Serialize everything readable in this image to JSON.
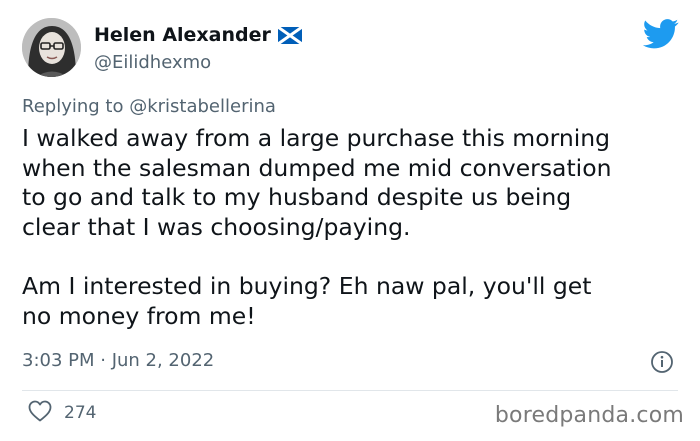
{
  "author": {
    "display_name": "Helen Alexander",
    "handle": "@Eilidhexmo",
    "flag_icon": "scotland-flag-icon",
    "avatar_icon": "profile-photo"
  },
  "brand": {
    "icon": "twitter-bird-icon",
    "color": "#1d9bf0"
  },
  "reply": {
    "prefix": "Replying to",
    "mention": "@kristabellerina"
  },
  "tweet": {
    "lines_paragraph_1": [
      "I walked away from a large purchase this morning",
      "when the salesman dumped me mid conversation",
      "to go and talk to my husband despite us being",
      "clear that I was choosing/paying."
    ],
    "lines_paragraph_2": [
      "Am I interested in buying?  Eh naw pal, you'll get",
      "no money from me!"
    ]
  },
  "meta": {
    "timestamp": "3:03 PM · Jun 2, 2022",
    "info_icon": "info-icon"
  },
  "engagement": {
    "like_icon": "heart-icon",
    "like_count": "274"
  },
  "watermark": "boredpanda.com",
  "colors": {
    "text": "#0f1419",
    "secondary": "#536471",
    "divider": "#e1e6ea"
  }
}
